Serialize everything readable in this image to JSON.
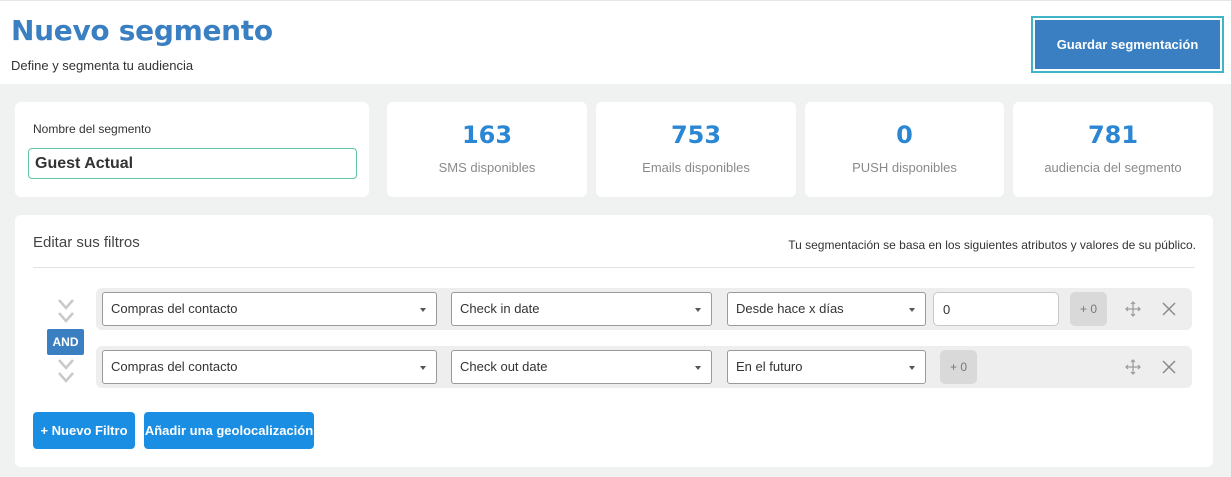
{
  "header": {
    "title": "Nuevo segmento",
    "subtitle": "Define y segmenta tu audiencia",
    "save_label": "Guardar segmentación"
  },
  "segment": {
    "name_label": "Nombre del segmento",
    "name_value": "Guest Actual"
  },
  "stats": [
    {
      "value": "163",
      "label": "SMS disponibles"
    },
    {
      "value": "753",
      "label": "Emails disponibles"
    },
    {
      "value": "0",
      "label": "PUSH disponibles"
    },
    {
      "value": "781",
      "label": "audiencia del segmento"
    }
  ],
  "filters": {
    "title": "Editar sus filtros",
    "note": "Tu segmentación se basa en los siguientes atributos y valores de su público.",
    "operator": "AND",
    "rows": [
      {
        "field": "Compras del contacto",
        "attribute": "Check in date",
        "condition": "Desde hace x días",
        "value": "0",
        "plus_label": "+ 0"
      },
      {
        "field": "Compras del contacto",
        "attribute": "Check out date",
        "condition": "En el futuro",
        "plus_label": "+ 0"
      }
    ],
    "new_filter_label": "+ Nuevo Filtro",
    "geo_label": "Añadir una geolocalización"
  },
  "icons": {
    "chevron": "chevron-down-icon",
    "move": "move-icon",
    "close": "close-icon"
  },
  "colors": {
    "title_blue": "#3a7fc1",
    "stat_blue": "#2b87d4",
    "button_blue": "#1a8ee3",
    "focus_teal": "#3fb6c8",
    "input_green": "#5fc6a8"
  }
}
